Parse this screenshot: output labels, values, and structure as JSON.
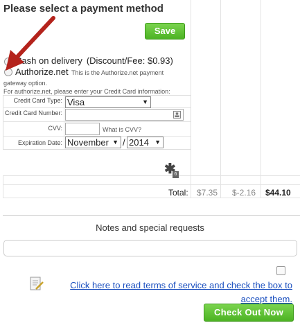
{
  "title": "Please select a payment method",
  "save_label": "Save",
  "payment": {
    "cod_label": "Cash on delivery",
    "cod_fee": "(Discount/Fee: $0.93)",
    "authorize_label": "Authorize.net",
    "authorize_desc_1": "This is the Authorize.net payment",
    "authorize_desc_2": "gateway option.",
    "authorize_instructions": "For authorize.net, please enter your Credit Card information:"
  },
  "credit_card": {
    "type_label": "Credit Card Type:",
    "type_value": "Visa",
    "number_label": "Credit Card Number:",
    "cvv_label": "CVV:",
    "cvv_help": "What is CVV?",
    "expiration_label": "Expiration Date:",
    "month_value": "November",
    "separator": "/",
    "year_value": "2014"
  },
  "totals": {
    "label": "Total:",
    "subtotal": "$7.35",
    "discount": "$-2.16",
    "grand_total": "$44.10"
  },
  "notes": {
    "heading": "Notes and special requests"
  },
  "terms": {
    "link_text": "Click here to read terms of service and check the box to accept them."
  },
  "checkout_label": "Check Out Now",
  "icons": {
    "arrow": "red-arrow-annotation",
    "asterisk": "asterisk-icon",
    "contact": "contact-card-icon",
    "terms": "document-pen-icon"
  },
  "colors": {
    "button_green": "#4cb323",
    "link_blue": "#1a4fbf",
    "arrow_red": "#b4231c"
  }
}
